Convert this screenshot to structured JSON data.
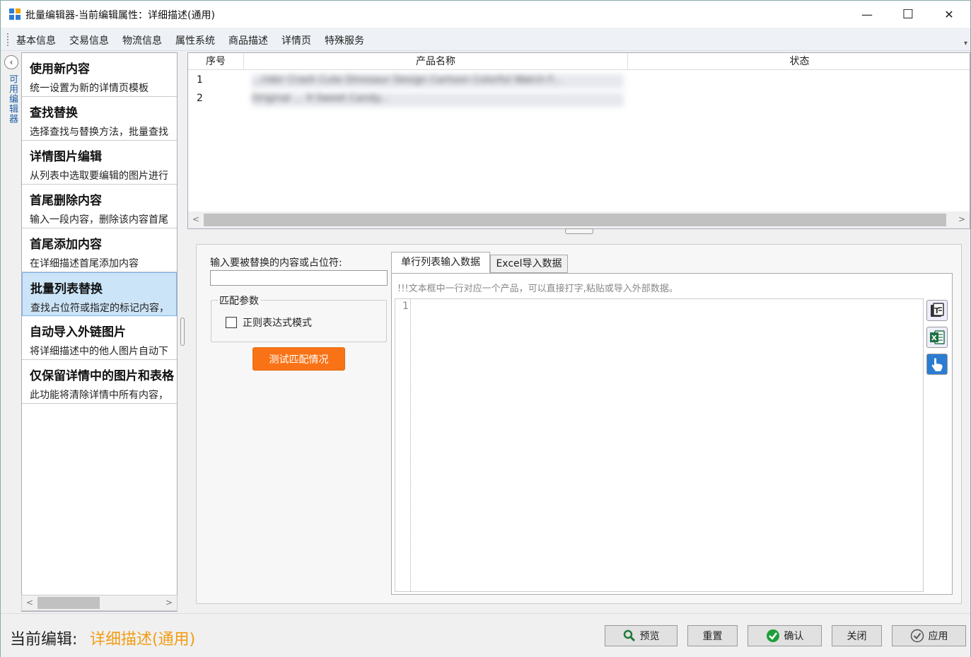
{
  "window": {
    "title": "批量编辑器-当前编辑属性：详细描述(通用)",
    "minimize": "—",
    "maximize": "☐",
    "close": "✕"
  },
  "menu": {
    "items": [
      "基本信息",
      "交易信息",
      "物流信息",
      "属性系统",
      "商品描述",
      "详情页",
      "特殊服务"
    ],
    "overflow": "▾"
  },
  "side_tab": {
    "toggle": "‹",
    "label": "可用编辑器"
  },
  "features": [
    {
      "title": "使用新内容",
      "desc": "统一设置为新的详情页模板"
    },
    {
      "title": "查找替换",
      "desc": "选择查找与替换方法，批量查找"
    },
    {
      "title": "详情图片编辑",
      "desc": "从列表中选取要编辑的图片进行"
    },
    {
      "title": "首尾删除内容",
      "desc": "输入一段内容，删除该内容首尾"
    },
    {
      "title": "首尾添加内容",
      "desc": "在详细描述首尾添加内容"
    },
    {
      "title": "批量列表替换",
      "desc": "查找占位符或指定的标记内容，"
    },
    {
      "title": "自动导入外链图片",
      "desc": "将详细描述中的他人图片自动下"
    },
    {
      "title": "仅保留详情中的图片和表格",
      "desc": "此功能将清除详情中所有内容，"
    }
  ],
  "selected_feature_index": 5,
  "grid": {
    "columns": [
      "序号",
      "产品名称",
      "状态"
    ],
    "rows": [
      {
        "index": "1",
        "name": "...rider Crash Cute Dinosaur Design Cartoon Colorful Watch F..."
      },
      {
        "index": "2",
        "name": "Original ... 9 Sweet Candy..."
      }
    ]
  },
  "editor": {
    "input_label": "输入要被替换的内容或占位符:",
    "input_value": "",
    "group_title": "匹配参数",
    "regex_label": "正则表达式模式",
    "regex_checked": false,
    "test_button": "测试匹配情况",
    "tabs": [
      "单行列表输入数据",
      "Excel导入数据"
    ],
    "active_tab": 0,
    "hint": "!!!文本框中一行对应一个产品，可以直接打字,粘贴或导入外部数据。",
    "line_number": "1",
    "side_icons": [
      "text-import-icon",
      "excel-import-icon",
      "touch-input-icon"
    ]
  },
  "footer": {
    "current_label": "当前编辑:",
    "current_value": "详细描述(通用)",
    "buttons": {
      "preview": "预览",
      "reset": "重置",
      "confirm": "确认",
      "close": "关闭",
      "apply": "应用"
    }
  },
  "colors": {
    "accent_orange": "#f97316",
    "current_value": "#f39c12",
    "selection": "#cce4f7",
    "confirm_green": "#1e9e3a"
  }
}
